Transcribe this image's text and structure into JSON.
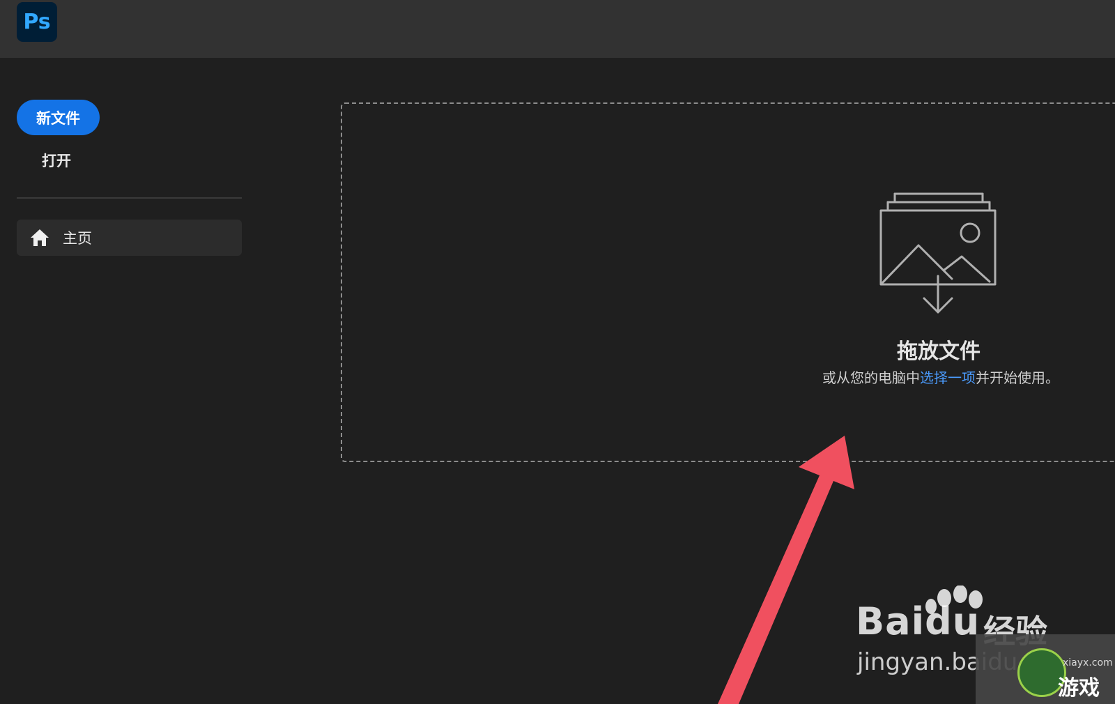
{
  "app": {
    "logo_text": "Ps",
    "brand_color": "#31a8ff",
    "logo_bg": "#001e36"
  },
  "sidebar": {
    "new_file_label": "新文件",
    "open_label": "打开",
    "items": [
      {
        "label": "主页",
        "icon": "home-icon"
      }
    ],
    "accent": "#1473e6"
  },
  "dropzone": {
    "icon": "image-drop-icon",
    "title": "拖放文件",
    "subtitle_prefix": "或从您的电脑中",
    "subtitle_link": "选择一项",
    "subtitle_suffix": "并开始使用。",
    "link_color": "#4b9cff"
  },
  "watermark": {
    "brand": "Bai",
    "brand_paw": "du",
    "brand_cn": "经验",
    "url": "jingyan.baidu",
    "game_site": "xiayx.com",
    "game_cn": "游戏"
  },
  "annotation": {
    "arrow_color": "#f0505f"
  }
}
